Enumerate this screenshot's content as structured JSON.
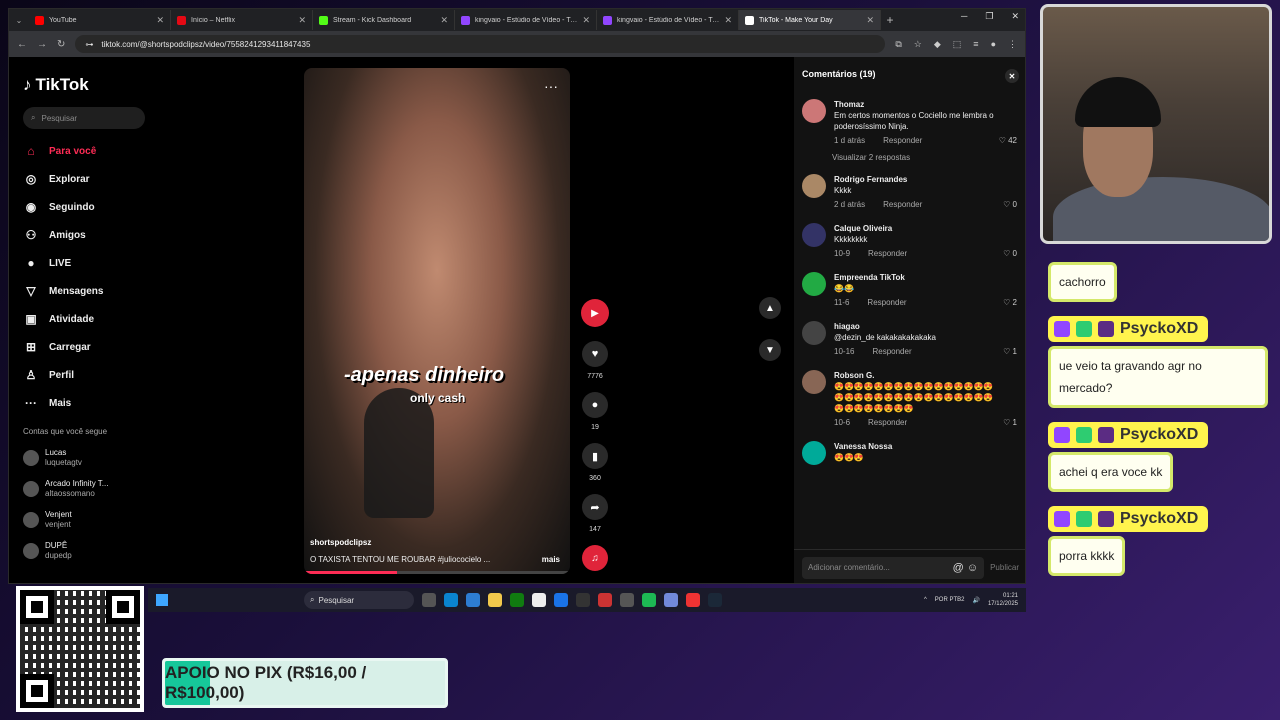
{
  "browser": {
    "tabs": [
      {
        "label": "YouTube",
        "color": "#ff0000"
      },
      {
        "label": "Início – Netflix",
        "color": "#e50914"
      },
      {
        "label": "Stream - Kick Dashboard",
        "color": "#53fc18"
      },
      {
        "label": "kingvaio - Estúdio de Vídeo - Twitch",
        "color": "#9146ff"
      },
      {
        "label": "kingvaio - Estúdio de Vídeo - Twitch",
        "color": "#9146ff"
      },
      {
        "label": "TikTok - Make Your Day",
        "color": "#ffffff"
      }
    ],
    "url": "tiktok.com/@shortspodclipsz/video/7558241293411847435"
  },
  "sidebar": {
    "logo": "TikTok",
    "search_placeholder": "Pesquisar",
    "nav": [
      {
        "label": "Para você",
        "icon": "home-icon",
        "glyph": "⌂",
        "active": true
      },
      {
        "label": "Explorar",
        "icon": "compass-icon",
        "glyph": "◎",
        "active": false
      },
      {
        "label": "Seguindo",
        "icon": "following-icon",
        "glyph": "◉",
        "active": false
      },
      {
        "label": "Amigos",
        "icon": "friends-icon",
        "glyph": "⚇",
        "active": false
      },
      {
        "label": "LIVE",
        "icon": "live-icon",
        "glyph": "●",
        "active": false
      },
      {
        "label": "Mensagens",
        "icon": "messages-icon",
        "glyph": "▽",
        "active": false
      },
      {
        "label": "Atividade",
        "icon": "activity-icon",
        "glyph": "▣",
        "active": false
      },
      {
        "label": "Carregar",
        "icon": "upload-icon",
        "glyph": "⊞",
        "active": false
      },
      {
        "label": "Perfil",
        "icon": "profile-icon",
        "glyph": "♙",
        "active": false
      },
      {
        "label": "Mais",
        "icon": "more-icon",
        "glyph": "···",
        "active": false
      }
    ],
    "following_header": "Contas que você segue",
    "following": [
      {
        "name": "Lucas",
        "handle": "luquetagtv"
      },
      {
        "name": "Arcado Infinity T...",
        "handle": "altaossomano"
      },
      {
        "name": "Venjent",
        "handle": "venjent"
      },
      {
        "name": "DUPÊ",
        "handle": "dupedp"
      }
    ]
  },
  "video": {
    "caption_main": "-apenas dinheiro",
    "caption_sub": "only cash",
    "author": "shortspodclipsz",
    "description": "O TAXISTA TENTOU ME ROUBAR  #juliococielo  ...",
    "more": "mais",
    "progress": 0.35
  },
  "actions": {
    "likes": "7776",
    "comments": "19",
    "saves": "360",
    "shares": "147"
  },
  "comments": {
    "title": "Comentários (19)",
    "reply_label": "Responder",
    "view_replies": "Visualizar 2 respostas",
    "items": [
      {
        "name": "Thomaz",
        "text": "Em certos momentos o Cociello me lembra o poderosíssimo Ninja.",
        "time": "1 d atrás",
        "likes": "42",
        "color": "#c77"
      },
      {
        "name": "Rodrigo Fernandes",
        "text": "Kkkk",
        "time": "2 d atrás",
        "likes": "0",
        "color": "#a86"
      },
      {
        "name": "Calque Oliveira",
        "text": "Kkkkkkkk",
        "time": "10-9",
        "likes": "0",
        "color": "#336"
      },
      {
        "name": "Empreenda TikTok",
        "text": "😂😂",
        "time": "11-6",
        "likes": "2",
        "color": "#2a4"
      },
      {
        "name": "hiagao",
        "text": "@dezin_de kakakakakakaka",
        "time": "10-16",
        "likes": "1",
        "color": "#444"
      },
      {
        "name": "Robson G.",
        "text": "😍😍😍😍😍😍😍😍😍😍😍😍😍😍😍😍😍😍😍😍😍😍😍😍😍😍😍😍😍😍😍😍😍😍😍😍😍😍😍😍",
        "time": "10-6",
        "likes": "1",
        "color": "#865"
      },
      {
        "name": "Vanessa Nossa",
        "text": "😍😍😍",
        "time": "",
        "likes": "",
        "color": "#0a9"
      }
    ],
    "input_placeholder": "Adicionar comentário...",
    "publish": "Publicar"
  },
  "taskbar": {
    "search": "Pesquisar",
    "lang": "POR PTB2",
    "time": "01:21",
    "date": "17/12/2025"
  },
  "overlay_chat": [
    {
      "user": "",
      "message": "cachorro"
    },
    {
      "user": "PsyckoXD",
      "message": "ue veio ta gravando agr no mercado?"
    },
    {
      "user": "PsyckoXD",
      "message": "achei q era voce kk"
    },
    {
      "user": "PsyckoXD",
      "message": "porra kkkk"
    }
  ],
  "pix_banner": {
    "label": "APOIO NO PIX (R$16,00 / R$100,00)",
    "progress": 0.16
  }
}
